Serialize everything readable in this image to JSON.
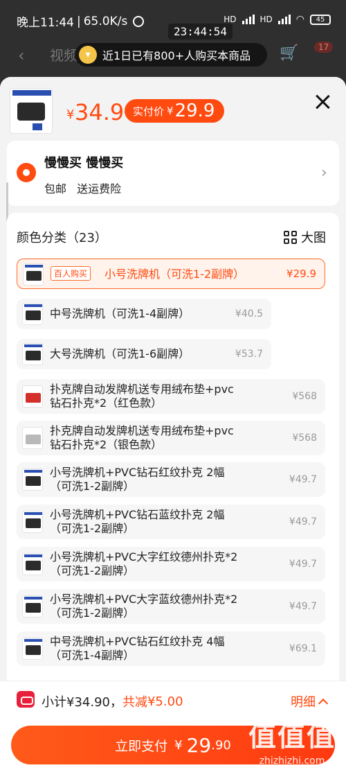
{
  "status_bar": {
    "time": "晚上11:44",
    "speed": "65.0K/s",
    "signal_label_1": "HD",
    "signal_label_2": "HD",
    "battery": "45"
  },
  "timestamp_overlay": "23:44:54",
  "background_nav": {
    "back_glyph": "‹",
    "title": "视频",
    "cart_glyph": "🛒",
    "cart_badge": "17"
  },
  "purchase_toast": {
    "text": "近1日已有800+人购买本商品"
  },
  "header": {
    "price_yen": "¥",
    "price": "34.9",
    "net_label": "实付价",
    "net_yen": "¥",
    "net_value": "29.9"
  },
  "address": {
    "name": "慢慢买 慢慢买",
    "shipping": "包邮",
    "insurance": "送运费险"
  },
  "sku": {
    "title": "颜色分类（23）",
    "big_view": "大图",
    "options": [
      {
        "tag": "百人购买",
        "name": "小号洗牌机（可洗1-2副牌）",
        "price": "¥29.9"
      },
      {
        "name": "中号洗牌机（可洗1-4副牌）",
        "price": "¥40.5"
      },
      {
        "name": "大号洗牌机（可洗1-6副牌）",
        "price": "¥53.7"
      },
      {
        "line1": "扑克牌自动发牌机送专用绒布垫+pvc",
        "line2": "钻石扑克*2（红色款）",
        "price": "¥568"
      },
      {
        "line1": "扑克牌自动发牌机送专用绒布垫+pvc",
        "line2": "钻石扑克*2（银色款）",
        "price": "¥568"
      },
      {
        "line1": "小号洗牌机+PVC钻石红纹扑克 2幅",
        "line2": "（可洗1-2副牌）",
        "price": "¥49.7"
      },
      {
        "line1": "小号洗牌机+PVC钻石蓝纹扑克 2幅",
        "line2": "（可洗1-2副牌）",
        "price": "¥49.7"
      },
      {
        "line1": "小号洗牌机+PVC大字红纹德州扑克*2",
        "line2": "（可洗1-2副牌）",
        "price": "¥49.7"
      },
      {
        "line1": "小号洗牌机+PVC大字蓝纹德州扑克*2",
        "line2": "（可洗1-2副牌）",
        "price": "¥49.7"
      },
      {
        "line1": "中号洗牌机+PVC钻石红纹扑克 4幅",
        "line2": "（可洗1-4副牌）",
        "price": "¥69.1"
      }
    ]
  },
  "bottom": {
    "subtotal_label": "小计",
    "subtotal_value": "¥34.90，",
    "discount_label": "共减",
    "discount_value": "¥5.00",
    "detail": "明细",
    "pay_label": "立即支付",
    "pay_yen": "¥",
    "pay_int": "29",
    "pay_dec": ".90"
  },
  "watermark": {
    "big": "值值值",
    "small": "zhizhizhi.com"
  },
  "colors": {
    "accent": "#ff4a10",
    "coupon_red": "#e8213b"
  }
}
